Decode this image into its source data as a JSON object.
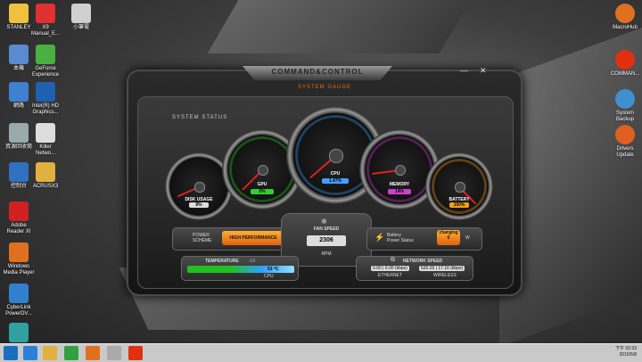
{
  "desktop_left": [
    {
      "label": "STANLEY",
      "color": "#f0c040"
    },
    {
      "label": "X9\nManual_E...",
      "color": "#e03030"
    },
    {
      "label": "小筆電",
      "color": "#d0d0d0"
    },
    {
      "label": "本機",
      "color": "#5a8ad0"
    },
    {
      "label": "GeForce\nExperience",
      "color": "#4ab040"
    },
    {
      "label": "網路",
      "color": "#4080d0"
    },
    {
      "label": "Intel(R) HD\nGraphics...",
      "color": "#2060b0"
    },
    {
      "label": "資源回收筒",
      "color": "#9aa"
    },
    {
      "label": "Killer\nNetwo...",
      "color": "#ddd"
    },
    {
      "label": "控制台",
      "color": "#3070c0"
    },
    {
      "label": "ACRUSX3",
      "color": "#e0b040"
    },
    {
      "label": "Adobe\nReader XI",
      "color": "#d02020"
    },
    {
      "label": "Windows\nMedia Player",
      "color": "#e07020"
    },
    {
      "label": "CyberLink\nPowerDV...",
      "color": "#3080d0"
    },
    {
      "label": "",
      "color": "#30a0a0"
    }
  ],
  "desktop_right": [
    {
      "label": "MacroHub",
      "color": "#e07020"
    },
    {
      "label": "COMMAN...",
      "color": "#e03010"
    },
    {
      "label": "System\nBackup",
      "color": "#4090d0"
    },
    {
      "label": "Drivers\nUpdate",
      "color": "#e06020"
    }
  ],
  "window": {
    "title": "COMMAND&CONTROL",
    "subtitle": "SYSTEM GAUGE",
    "minimize": "—",
    "close": "✕",
    "system_status": "SYSTEM STATUS"
  },
  "gauges": [
    {
      "label": "DISK USAGE",
      "value": "8%",
      "fraction": 0.08,
      "color": "#ddd"
    },
    {
      "label": "GPU",
      "value": "0%",
      "fraction": 0.0,
      "color": "#30d030"
    },
    {
      "label": "CPU",
      "value": "1.47%",
      "fraction": 0.0147,
      "color": "#40a0ff"
    },
    {
      "label": "MEMORY",
      "value": "14%",
      "fraction": 0.14,
      "color": "#d040d0"
    },
    {
      "label": "BATTERY",
      "value": "100%",
      "fraction": 1.0,
      "color": "#f0a020"
    }
  ],
  "power": {
    "label": "POWER\nSCHEME",
    "value": "HIGH PERFORMANCE"
  },
  "fan": {
    "label": "FAN SPEED",
    "value": "2306",
    "unit": "RPM"
  },
  "battery": {
    "label": "Battery\nPower Status",
    "value": "charging\n0",
    "unit": "W"
  },
  "temperature": {
    "label": "TEMPERATURE",
    "value": "53 ℃",
    "source": "CPU"
  },
  "network": {
    "label": "NETWORK SPEED",
    "ethernet_value": "0.00 | 0.00 (kbps)",
    "ethernet": "ETHERNET",
    "wireless_value": "520.03 | 17.16 (kbps)",
    "wireless": "WIRELESS"
  },
  "taskbar": {
    "time": "下午 02:33",
    "date": "2015/5/8"
  }
}
